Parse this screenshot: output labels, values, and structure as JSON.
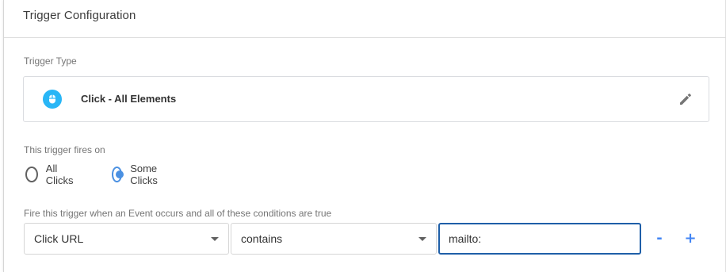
{
  "panel": {
    "title": "Trigger Configuration"
  },
  "trigger_type": {
    "label": "Trigger Type",
    "name": "Click - All Elements",
    "icon": "mouse-icon",
    "icon_color": "#29b6f6",
    "edit_icon": "pencil-icon"
  },
  "fires_on": {
    "label": "This trigger fires on",
    "options": [
      {
        "label": "All Clicks",
        "selected": false
      },
      {
        "label": "Some Clicks",
        "selected": true
      }
    ]
  },
  "condition": {
    "label": "Fire this trigger when an Event occurs and all of these conditions are true",
    "variable": "Click URL",
    "operator": "contains",
    "value": "mailto:",
    "remove_label": "-",
    "add_label": "+"
  },
  "colors": {
    "accent": "#4285f4",
    "radio_selected": "#4a90e2",
    "input_focus": "#1f5fa8"
  }
}
